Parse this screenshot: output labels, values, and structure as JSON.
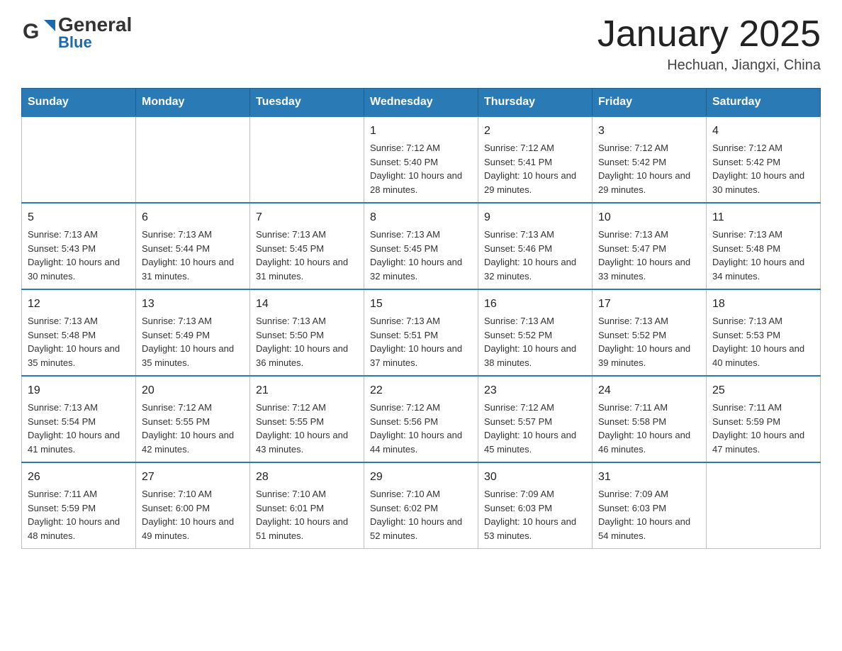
{
  "header": {
    "logo": {
      "general": "General",
      "blue": "Blue"
    },
    "title": "January 2025",
    "location": "Hechuan, Jiangxi, China"
  },
  "days_of_week": [
    "Sunday",
    "Monday",
    "Tuesday",
    "Wednesday",
    "Thursday",
    "Friday",
    "Saturday"
  ],
  "weeks": [
    [
      {
        "day": "",
        "sunrise": "",
        "sunset": "",
        "daylight": ""
      },
      {
        "day": "",
        "sunrise": "",
        "sunset": "",
        "daylight": ""
      },
      {
        "day": "",
        "sunrise": "",
        "sunset": "",
        "daylight": ""
      },
      {
        "day": "1",
        "sunrise": "Sunrise: 7:12 AM",
        "sunset": "Sunset: 5:40 PM",
        "daylight": "Daylight: 10 hours and 28 minutes."
      },
      {
        "day": "2",
        "sunrise": "Sunrise: 7:12 AM",
        "sunset": "Sunset: 5:41 PM",
        "daylight": "Daylight: 10 hours and 29 minutes."
      },
      {
        "day": "3",
        "sunrise": "Sunrise: 7:12 AM",
        "sunset": "Sunset: 5:42 PM",
        "daylight": "Daylight: 10 hours and 29 minutes."
      },
      {
        "day": "4",
        "sunrise": "Sunrise: 7:12 AM",
        "sunset": "Sunset: 5:42 PM",
        "daylight": "Daylight: 10 hours and 30 minutes."
      }
    ],
    [
      {
        "day": "5",
        "sunrise": "Sunrise: 7:13 AM",
        "sunset": "Sunset: 5:43 PM",
        "daylight": "Daylight: 10 hours and 30 minutes."
      },
      {
        "day": "6",
        "sunrise": "Sunrise: 7:13 AM",
        "sunset": "Sunset: 5:44 PM",
        "daylight": "Daylight: 10 hours and 31 minutes."
      },
      {
        "day": "7",
        "sunrise": "Sunrise: 7:13 AM",
        "sunset": "Sunset: 5:45 PM",
        "daylight": "Daylight: 10 hours and 31 minutes."
      },
      {
        "day": "8",
        "sunrise": "Sunrise: 7:13 AM",
        "sunset": "Sunset: 5:45 PM",
        "daylight": "Daylight: 10 hours and 32 minutes."
      },
      {
        "day": "9",
        "sunrise": "Sunrise: 7:13 AM",
        "sunset": "Sunset: 5:46 PM",
        "daylight": "Daylight: 10 hours and 32 minutes."
      },
      {
        "day": "10",
        "sunrise": "Sunrise: 7:13 AM",
        "sunset": "Sunset: 5:47 PM",
        "daylight": "Daylight: 10 hours and 33 minutes."
      },
      {
        "day": "11",
        "sunrise": "Sunrise: 7:13 AM",
        "sunset": "Sunset: 5:48 PM",
        "daylight": "Daylight: 10 hours and 34 minutes."
      }
    ],
    [
      {
        "day": "12",
        "sunrise": "Sunrise: 7:13 AM",
        "sunset": "Sunset: 5:48 PM",
        "daylight": "Daylight: 10 hours and 35 minutes."
      },
      {
        "day": "13",
        "sunrise": "Sunrise: 7:13 AM",
        "sunset": "Sunset: 5:49 PM",
        "daylight": "Daylight: 10 hours and 35 minutes."
      },
      {
        "day": "14",
        "sunrise": "Sunrise: 7:13 AM",
        "sunset": "Sunset: 5:50 PM",
        "daylight": "Daylight: 10 hours and 36 minutes."
      },
      {
        "day": "15",
        "sunrise": "Sunrise: 7:13 AM",
        "sunset": "Sunset: 5:51 PM",
        "daylight": "Daylight: 10 hours and 37 minutes."
      },
      {
        "day": "16",
        "sunrise": "Sunrise: 7:13 AM",
        "sunset": "Sunset: 5:52 PM",
        "daylight": "Daylight: 10 hours and 38 minutes."
      },
      {
        "day": "17",
        "sunrise": "Sunrise: 7:13 AM",
        "sunset": "Sunset: 5:52 PM",
        "daylight": "Daylight: 10 hours and 39 minutes."
      },
      {
        "day": "18",
        "sunrise": "Sunrise: 7:13 AM",
        "sunset": "Sunset: 5:53 PM",
        "daylight": "Daylight: 10 hours and 40 minutes."
      }
    ],
    [
      {
        "day": "19",
        "sunrise": "Sunrise: 7:13 AM",
        "sunset": "Sunset: 5:54 PM",
        "daylight": "Daylight: 10 hours and 41 minutes."
      },
      {
        "day": "20",
        "sunrise": "Sunrise: 7:12 AM",
        "sunset": "Sunset: 5:55 PM",
        "daylight": "Daylight: 10 hours and 42 minutes."
      },
      {
        "day": "21",
        "sunrise": "Sunrise: 7:12 AM",
        "sunset": "Sunset: 5:55 PM",
        "daylight": "Daylight: 10 hours and 43 minutes."
      },
      {
        "day": "22",
        "sunrise": "Sunrise: 7:12 AM",
        "sunset": "Sunset: 5:56 PM",
        "daylight": "Daylight: 10 hours and 44 minutes."
      },
      {
        "day": "23",
        "sunrise": "Sunrise: 7:12 AM",
        "sunset": "Sunset: 5:57 PM",
        "daylight": "Daylight: 10 hours and 45 minutes."
      },
      {
        "day": "24",
        "sunrise": "Sunrise: 7:11 AM",
        "sunset": "Sunset: 5:58 PM",
        "daylight": "Daylight: 10 hours and 46 minutes."
      },
      {
        "day": "25",
        "sunrise": "Sunrise: 7:11 AM",
        "sunset": "Sunset: 5:59 PM",
        "daylight": "Daylight: 10 hours and 47 minutes."
      }
    ],
    [
      {
        "day": "26",
        "sunrise": "Sunrise: 7:11 AM",
        "sunset": "Sunset: 5:59 PM",
        "daylight": "Daylight: 10 hours and 48 minutes."
      },
      {
        "day": "27",
        "sunrise": "Sunrise: 7:10 AM",
        "sunset": "Sunset: 6:00 PM",
        "daylight": "Daylight: 10 hours and 49 minutes."
      },
      {
        "day": "28",
        "sunrise": "Sunrise: 7:10 AM",
        "sunset": "Sunset: 6:01 PM",
        "daylight": "Daylight: 10 hours and 51 minutes."
      },
      {
        "day": "29",
        "sunrise": "Sunrise: 7:10 AM",
        "sunset": "Sunset: 6:02 PM",
        "daylight": "Daylight: 10 hours and 52 minutes."
      },
      {
        "day": "30",
        "sunrise": "Sunrise: 7:09 AM",
        "sunset": "Sunset: 6:03 PM",
        "daylight": "Daylight: 10 hours and 53 minutes."
      },
      {
        "day": "31",
        "sunrise": "Sunrise: 7:09 AM",
        "sunset": "Sunset: 6:03 PM",
        "daylight": "Daylight: 10 hours and 54 minutes."
      },
      {
        "day": "",
        "sunrise": "",
        "sunset": "",
        "daylight": ""
      }
    ]
  ]
}
